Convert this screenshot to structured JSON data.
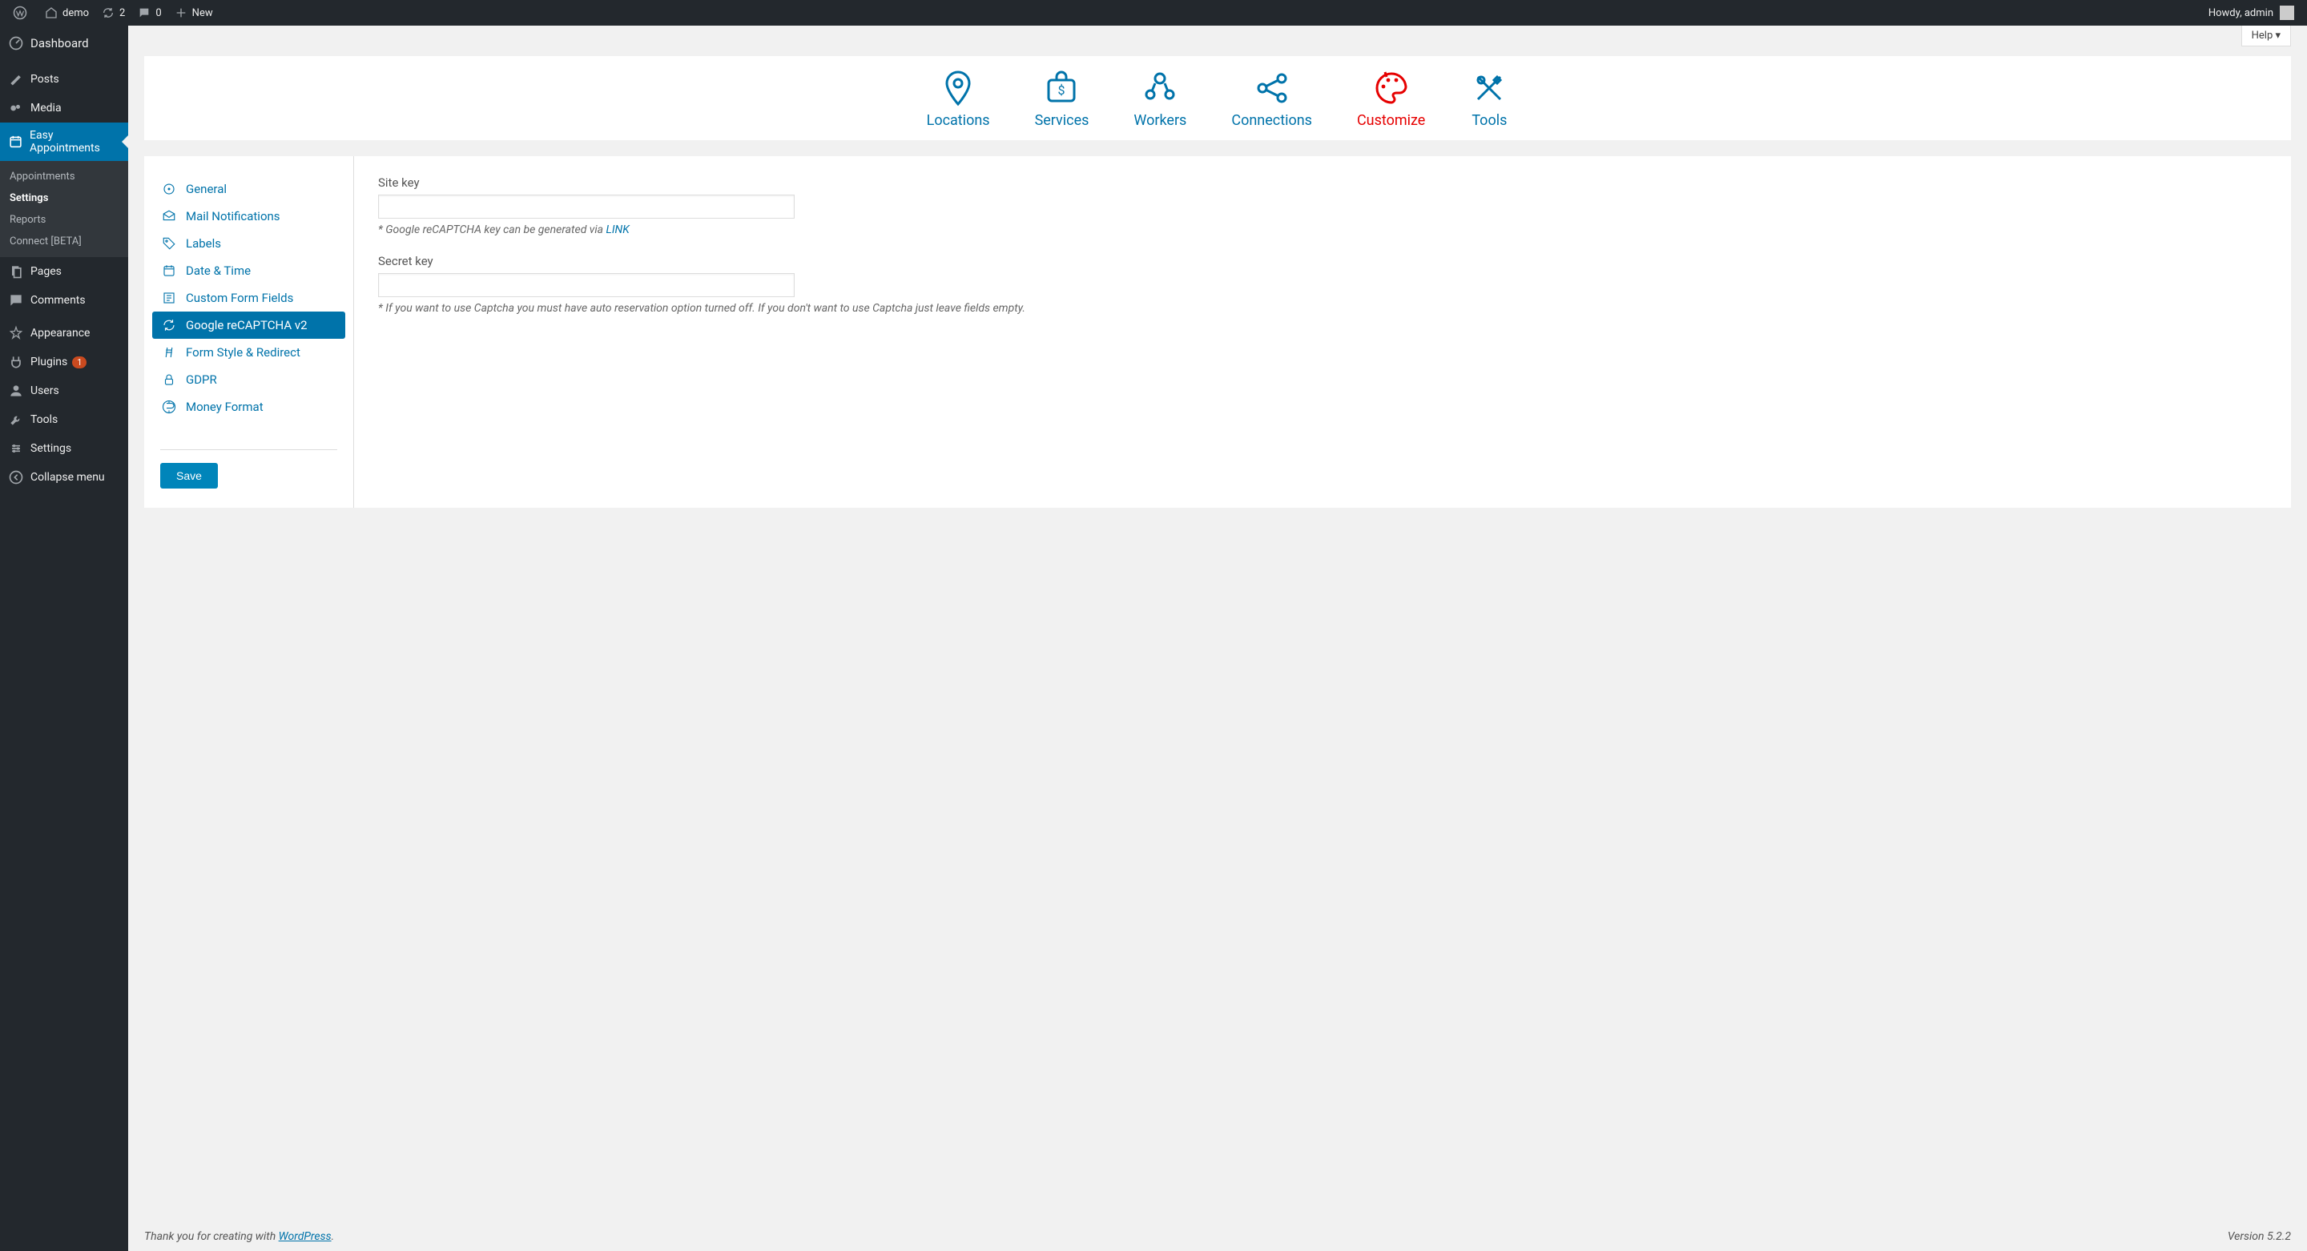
{
  "adminbar": {
    "site": "demo",
    "updates": "2",
    "comments": "0",
    "new": "New",
    "howdy": "Howdy, admin"
  },
  "sidebar": {
    "dashboard": "Dashboard",
    "posts": "Posts",
    "media": "Media",
    "easy": "Easy Appointments",
    "sub": {
      "appointments": "Appointments",
      "settings": "Settings",
      "reports": "Reports",
      "connect": "Connect [BETA]"
    },
    "pages": "Pages",
    "comments": "Comments",
    "appearance": "Appearance",
    "plugins": "Plugins",
    "plugins_badge": "1",
    "users": "Users",
    "tools": "Tools",
    "settings": "Settings",
    "collapse": "Collapse menu"
  },
  "help": "Help",
  "tabs": {
    "locations": "Locations",
    "services": "Services",
    "workers": "Workers",
    "connections": "Connections",
    "customize": "Customize",
    "tools": "Tools"
  },
  "sidenav": {
    "general": "General",
    "mail": "Mail Notifications",
    "labels": "Labels",
    "datetime": "Date & Time",
    "custom": "Custom Form Fields",
    "recaptcha": "Google reCAPTCHA v2",
    "style": "Form Style & Redirect",
    "gdpr": "GDPR",
    "money": "Money Format"
  },
  "save": "Save",
  "form": {
    "sitekey_label": "Site key",
    "sitekey_hint_pre": "* Google reCAPTCHA key can be generated via ",
    "sitekey_hint_link": "LINK",
    "secret_label": "Secret key",
    "secret_hint": "* If you want to use Captcha you must have auto reservation option turned off. If you don't want to use Captcha just leave fields empty."
  },
  "footer": {
    "thanks_pre": "Thank you for creating with ",
    "wp": "WordPress",
    "thanks_post": ".",
    "version": "Version 5.2.2"
  }
}
